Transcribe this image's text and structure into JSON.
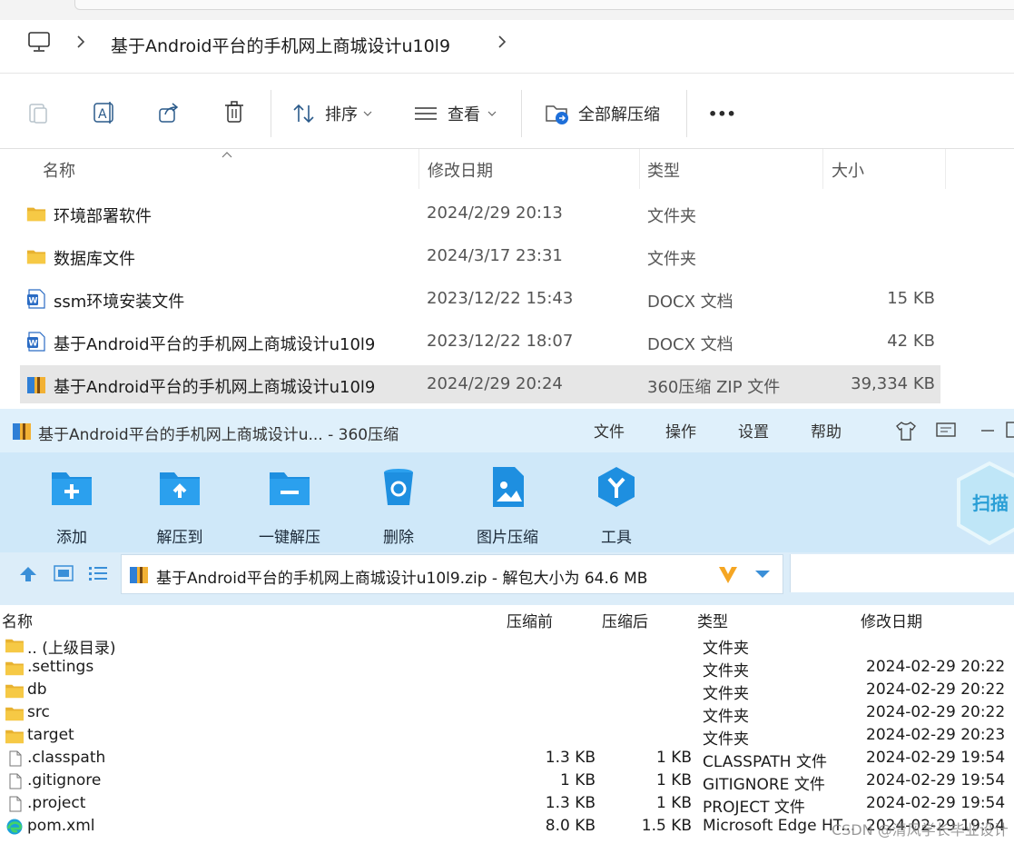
{
  "explorer": {
    "breadcrumb": {
      "folder": "基于Android平台的手机网上商城设计u10l9"
    },
    "toolbar": {
      "sort_label": "排序",
      "view_label": "查看",
      "extract_all_label": "全部解压缩",
      "more_label": "•••"
    },
    "columns": {
      "name": "名称",
      "date": "修改日期",
      "type": "类型",
      "size": "大小"
    },
    "rows": [
      {
        "name": "环境部署软件",
        "date": "2024/2/29 20:13",
        "type": "文件夹",
        "size": "",
        "icon": "folder-icon"
      },
      {
        "name": "数据库文件",
        "date": "2024/3/17 23:31",
        "type": "文件夹",
        "size": "",
        "icon": "folder-icon"
      },
      {
        "name": "ssm环境安装文件",
        "date": "2023/12/22 15:43",
        "type": "DOCX 文档",
        "size": "15 KB",
        "icon": "word-doc-icon"
      },
      {
        "name": "基于Android平台的手机网上商城设计u10l9",
        "date": "2023/12/22 18:07",
        "type": "DOCX 文档",
        "size": "42 KB",
        "icon": "word-doc-icon"
      },
      {
        "name": "基于Android平台的手机网上商城设计u10l9",
        "date": "2024/2/29 20:24",
        "type": "360压缩 ZIP 文件",
        "size": "39,334 KB",
        "icon": "zip-archive-icon"
      }
    ]
  },
  "zip": {
    "title": "基于Android平台的手机网上商城设计u... - 360压缩",
    "menu": [
      "文件",
      "操作",
      "设置",
      "帮助"
    ],
    "tools": [
      "添加",
      "解压到",
      "一键解压",
      "删除",
      "图片压缩",
      "工具"
    ],
    "scan_label": "扫描",
    "path": "基于Android平台的手机网上商城设计u10l9.zip - 解包大小为 64.6 MB",
    "columns": {
      "name": "名称",
      "pre": "压缩前",
      "post": "压缩后",
      "type": "类型",
      "date": "修改日期"
    },
    "rows": [
      {
        "name": ".. (上级目录)",
        "pre": "",
        "post": "",
        "type": "文件夹",
        "date": "",
        "icon": "folder-icon"
      },
      {
        "name": ".settings",
        "pre": "",
        "post": "",
        "type": "文件夹",
        "date": "2024-02-29 20:22",
        "icon": "folder-icon"
      },
      {
        "name": "db",
        "pre": "",
        "post": "",
        "type": "文件夹",
        "date": "2024-02-29 20:22",
        "icon": "folder-icon"
      },
      {
        "name": "src",
        "pre": "",
        "post": "",
        "type": "文件夹",
        "date": "2024-02-29 20:22",
        "icon": "folder-icon"
      },
      {
        "name": "target",
        "pre": "",
        "post": "",
        "type": "文件夹",
        "date": "2024-02-29 20:23",
        "icon": "folder-icon"
      },
      {
        "name": ".classpath",
        "pre": "1.3 KB",
        "post": "1 KB",
        "type": "CLASSPATH 文件",
        "date": "2024-02-29 19:54",
        "icon": "file-icon"
      },
      {
        "name": ".gitignore",
        "pre": "1 KB",
        "post": "1 KB",
        "type": "GITIGNORE 文件",
        "date": "2024-02-29 19:54",
        "icon": "file-icon"
      },
      {
        "name": ".project",
        "pre": "1.3 KB",
        "post": "1 KB",
        "type": "PROJECT 文件",
        "date": "2024-02-29 19:54",
        "icon": "file-icon"
      },
      {
        "name": "pom.xml",
        "pre": "8.0 KB",
        "post": "1.5 KB",
        "type": "Microsoft Edge HT...",
        "date": "2024-02-29 19:54",
        "icon": "edge-icon"
      }
    ],
    "watermark": "CSDN @清风学长毕业设计"
  }
}
